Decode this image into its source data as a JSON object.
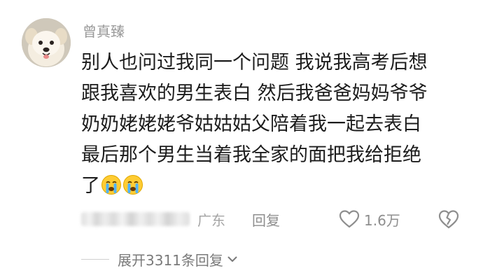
{
  "comment": {
    "author": "曾真臻",
    "lines": [
      "别人也问过我同一个问题 我说我高考后想",
      "跟我喜欢的男生表白 然后我爸爸妈妈爷爷",
      "奶奶姥姥姥爷姑姑姑父陪着我一起去表白",
      "最后那个男生当着我全家的面把我给拒绝",
      "了"
    ],
    "trailing_emojis": [
      "crying-face-emoji",
      "crying-face-emoji"
    ],
    "location": "广东",
    "reply_label": "回复",
    "like_count": "1.6万",
    "expand_label": "展开3311条回复"
  },
  "icons": {
    "like": "heart-outline-icon",
    "dislike": "broken-heart-icon",
    "expand": "chevron-down-icon"
  },
  "colors": {
    "text_primary": "#1c1c1c",
    "text_secondary": "#9a9a9a",
    "icon_gray": "#8e8e8e",
    "background": "#ffffff"
  }
}
